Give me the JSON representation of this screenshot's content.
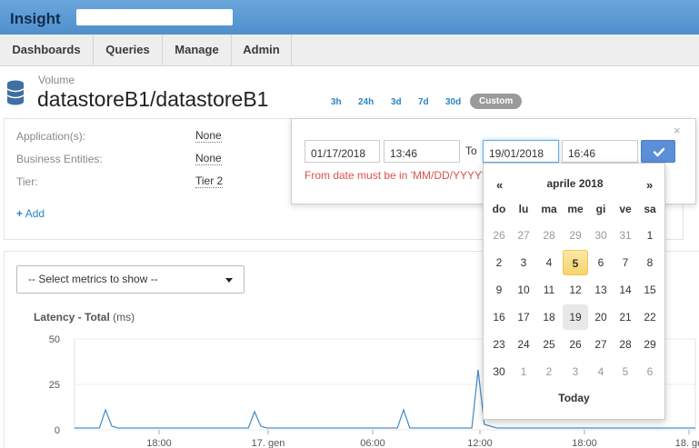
{
  "brand": {
    "title": "Insight"
  },
  "nav": {
    "items": [
      "Dashboards",
      "Queries",
      "Manage",
      "Admin"
    ]
  },
  "header": {
    "sub_label": "Volume",
    "title": "datastoreB1/datastoreB1",
    "time_ranges": [
      "3h",
      "24h",
      "3d",
      "7d",
      "30d"
    ],
    "custom_label": "Custom"
  },
  "info": {
    "rows": [
      {
        "label": "Application(s):",
        "value": "None"
      },
      {
        "label": "Business Entities:",
        "value": "None"
      },
      {
        "label": "Tier:",
        "value": "Tier 2"
      }
    ],
    "add_label": "Add"
  },
  "metrics": {
    "select_placeholder": "-- Select metrics to show --",
    "chart_title": "Latency - Total",
    "chart_unit": "(ms)"
  },
  "date_picker": {
    "from_date": "01/17/2018",
    "from_time": "13:46",
    "to_label": "To",
    "to_date": "19/01/2018",
    "to_time": "16:46",
    "error": "From date must be in 'MM/DD/YYYY'",
    "close": "×"
  },
  "calendar": {
    "prev": "«",
    "next": "»",
    "month_label": "aprile 2018",
    "weekdays": [
      "do",
      "lu",
      "ma",
      "me",
      "gi",
      "ve",
      "sa"
    ],
    "weeks": [
      [
        "26",
        "27",
        "28",
        "29",
        "30",
        "31",
        "1"
      ],
      [
        "2",
        "3",
        "4",
        "5",
        "6",
        "7",
        "8"
      ],
      [
        "9",
        "10",
        "11",
        "12",
        "13",
        "14",
        "15"
      ],
      [
        "16",
        "17",
        "18",
        "19",
        "20",
        "21",
        "22"
      ],
      [
        "23",
        "24",
        "25",
        "26",
        "27",
        "28",
        "29"
      ],
      [
        "30",
        "1",
        "2",
        "3",
        "4",
        "5",
        "6"
      ]
    ],
    "selected_day": "5",
    "today_day": "19",
    "today_label": "Today"
  },
  "chart_data": {
    "type": "line",
    "ylabel": "Latency - Total (ms)",
    "ylim": [
      0,
      50
    ],
    "yticks": [
      "50",
      "25",
      "0"
    ],
    "xticks": [
      "18:00",
      "17. gen",
      "06:00",
      "12:00",
      "18:00",
      "18. ge"
    ],
    "series": [
      {
        "color": "#4e8fc8",
        "x": [
          0,
          2,
          4,
          5,
          6,
          7,
          8,
          10,
          12,
          14,
          16,
          18,
          20,
          22,
          24,
          26,
          28,
          29,
          30,
          31,
          32,
          34,
          36,
          38,
          40,
          42,
          44,
          46,
          48,
          50,
          52,
          53,
          54,
          55,
          56,
          58,
          60,
          62,
          63,
          64,
          65,
          66,
          68,
          70,
          72,
          74,
          76,
          78,
          80,
          82,
          84,
          86,
          88,
          90,
          92,
          94,
          96,
          98,
          100
        ],
        "y": [
          1,
          1,
          1,
          11,
          2,
          1,
          1,
          1,
          1,
          1,
          1,
          1,
          1,
          1,
          1,
          1,
          1,
          10,
          2,
          1,
          1,
          1,
          1,
          1,
          1,
          1,
          1,
          1,
          1,
          1,
          1,
          11,
          1,
          1,
          1,
          1,
          1,
          1,
          1,
          1,
          33,
          3,
          1,
          1,
          1,
          1,
          1,
          1,
          1,
          1,
          1,
          1,
          1,
          1,
          1,
          1,
          1,
          1,
          1
        ]
      }
    ]
  }
}
